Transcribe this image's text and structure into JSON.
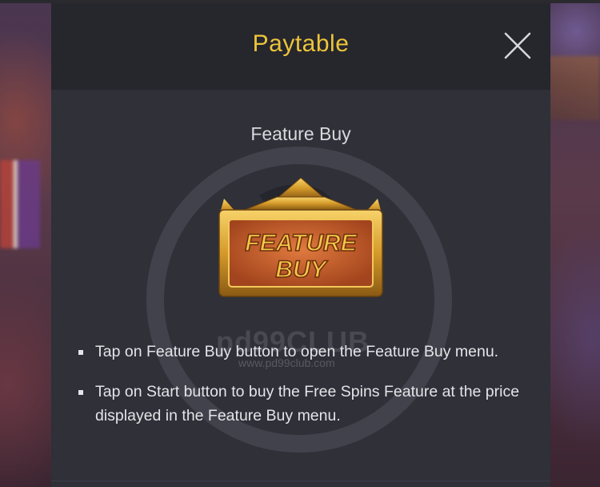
{
  "modal": {
    "title": "Paytable",
    "close_icon": "close-icon"
  },
  "section": {
    "title": "Feature Buy",
    "badge_text_line1": "FEATURE",
    "badge_text_line2": "BUY"
  },
  "rules": [
    "Tap on Feature Buy button to open the Feature Buy menu.",
    "Tap on Start button to buy the Free Spins Feature at the price displayed in the Feature Buy menu."
  ],
  "watermark": {
    "brand": "pd99CLUB",
    "url": "www.pd99club.com"
  },
  "colors": {
    "title": "#ecc53a",
    "panel": "#2f3038",
    "header": "#26262d",
    "text": "#e4e4e8"
  }
}
